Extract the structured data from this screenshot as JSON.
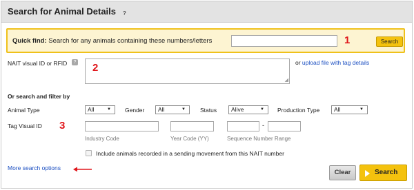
{
  "panel": {
    "title": "Search for Animal Details",
    "title_help": "?"
  },
  "quick_find": {
    "label_bold": "Quick find:",
    "label_text": "Search for any animals containing these numbers/letters",
    "input_value": "",
    "search_label": "Search",
    "annotation": "1"
  },
  "nait": {
    "label": "NAIT visual ID or RFID",
    "help": "?",
    "textarea_value": "",
    "annotation": "2",
    "or_text": "or ",
    "upload_link": "upload file with tag details"
  },
  "filters": {
    "section_title": "Or search and filter by",
    "animal_type_label": "Animal Type",
    "animal_type_value": "All",
    "gender_label": "Gender",
    "gender_value": "All",
    "status_label": "Status",
    "status_value": "Alive",
    "production_type_label": "Production Type",
    "production_type_value": "All"
  },
  "tag": {
    "label": "Tag Visual ID",
    "annotation": "3",
    "industry_code_hint": "Industry Code",
    "year_code_hint": "Year Code (YY)",
    "sequence_hint": "Sequence Number Range",
    "range_separator": "-",
    "industry_code_value": "",
    "year_code_value": "",
    "seq_from_value": "",
    "seq_to_value": ""
  },
  "sending_movement": {
    "label": "Include animals recorded in a sending movement from this NAIT number",
    "checked": false
  },
  "more_options": {
    "label": "More search options"
  },
  "actions": {
    "clear_label": "Clear",
    "search_label": "Search"
  },
  "colors": {
    "accent_yellow": "#f4c20e",
    "quickfind_bg": "#fdf4d2",
    "quickfind_border": "#efc11a",
    "link_blue": "#1a4ec1",
    "annotation_red": "#e0161b"
  },
  "icons": {
    "title_help": "help-icon",
    "nait_help": "help-icon",
    "search_button": "play-icon",
    "annotation_arrow": "arrow-left-icon"
  }
}
